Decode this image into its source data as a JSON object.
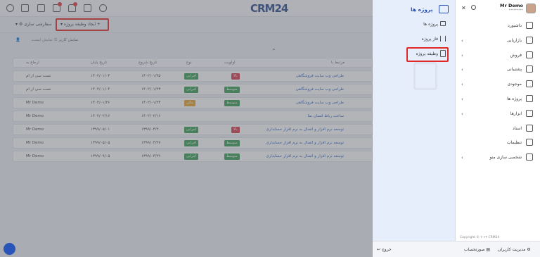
{
  "topbar": {
    "logo": "CRM24"
  },
  "subbar": {
    "create_label": "ایجاد وظیفه پروژه",
    "view_label": "سفارشی سازی"
  },
  "tools": {
    "user_view": "نمایش کاربر",
    "list_view": "نمایش لیست"
  },
  "table": {
    "headers": [
      "مرتبط با",
      "اولویت",
      "نوع",
      "تاریخ شروع",
      "تاریخ پایان",
      "ارجاع به"
    ],
    "rows": [
      {
        "title": "طراحی وب سایت فروشگاهی",
        "priority": "بالا",
        "priority_color": "#d13a4a",
        "type": "اجرایی",
        "start": "۱۴۰۲/۰۱/۲۵",
        "end": "۱۴۰۲/۰۱/۰۴",
        "assignee": "تست سی ار ام",
        "edge": true
      },
      {
        "title": "طراحی وب سایت فروشگاهی",
        "priority": "متوسط",
        "priority_color": "#3a9a52",
        "type": "اجرایی",
        "start": "۱۴۰۲/۰۱/۲۳",
        "end": "۱۴۰۲/۰۱/۰۴",
        "assignee": "تست سی ار ام",
        "edge": true
      },
      {
        "title": "طراحی وب سایت فروشگاهی",
        "priority": "متوسط",
        "priority_color": "#3a9a52",
        "type": "مالی",
        "start": "۱۴۰۲/۰۱/۲۴",
        "end": "۱۴۰۲/۰۱/۲۶",
        "assignee": "Mr Demo",
        "edge": true
      },
      {
        "title": "ساخت رباط انسان نما",
        "priority": "",
        "priority_color": "",
        "type": "",
        "start": "۱۴۰۲/۰۲/۱۶",
        "end": "۱۴۰۲/۰۲/۱۶",
        "assignee": "Mr Demo",
        "edge": false
      },
      {
        "title": "توسعه نرم افزار و اتصال به نرم افزار حسابداری",
        "priority": "بالا",
        "priority_color": "#d13a4a",
        "type": "اجرایی",
        "start": "۱۳۹۹/۰۴/۲۰",
        "end": "۱۳۹۹/۰۵/۰۱",
        "assignee": "Mr Demo",
        "edge": true
      },
      {
        "title": "توسعه نرم افزار و اتصال به نرم افزار حسابداری",
        "priority": "متوسط",
        "priority_color": "#3a9a52",
        "type": "اجرایی",
        "start": "۱۳۹۹/۰۴/۲۷",
        "end": "۱۳۹۹/۰۵/۰۵",
        "assignee": "Mr Demo",
        "edge": true
      },
      {
        "title": "توسعه نرم افزار و اتصال به نرم افزار حسابداری",
        "priority": "متوسط",
        "priority_color": "#3a9a52",
        "type": "اجرایی",
        "start": "۱۳۹۹/۰۴/۲۹",
        "end": "۱۳۹۹/۰۹/۰۵",
        "assignee": "Mr Demo",
        "edge": true
      }
    ]
  },
  "subpanel": {
    "title": "پروژه ها",
    "items": [
      "پروژه ها",
      "فاز پروژه",
      "وظیفه پروژه"
    ]
  },
  "mainpanel": {
    "user_name": "Mr Demo",
    "user_sub": "*********",
    "items": [
      {
        "label": "داشبورد",
        "chevron": false
      },
      {
        "label": "بازاریابی",
        "chevron": true
      },
      {
        "label": "فروش",
        "chevron": true
      },
      {
        "label": "پشتیبانی",
        "chevron": true
      },
      {
        "label": "موجودی",
        "chevron": true
      },
      {
        "label": "پروژه ها",
        "chevron": true
      },
      {
        "label": "ابزارها",
        "chevron": true
      },
      {
        "label": "اسناد",
        "chevron": false
      },
      {
        "label": "تنظیمات",
        "chevron": false
      },
      {
        "label": "شخصی سازی منو",
        "chevron": true
      }
    ],
    "copyright": "Copyright © ۲۰۲۳ CRM24"
  },
  "bottombar": {
    "manage_users": "مدیریت کاربران",
    "invoice": "صورتحساب",
    "logout": "خروج"
  },
  "colors": {
    "accent": "#2b4a8a",
    "highlight": "#e02828",
    "green": "#3a9a52",
    "red": "#d13a4a",
    "orange": "#e0a030"
  }
}
